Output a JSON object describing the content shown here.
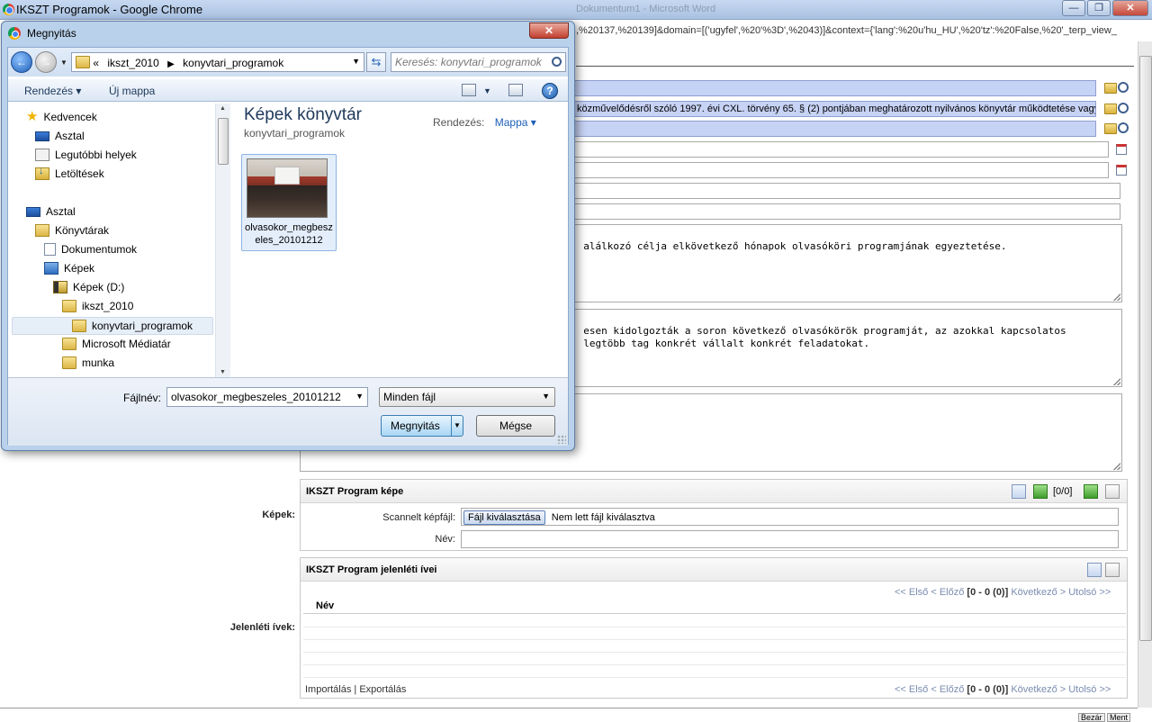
{
  "chrome": {
    "title": "IKSZT Programok - Google Chrome",
    "ghost_tabs": "Dokumentum1 - Microsoft Word",
    "url_fragment": ",%20137,%20139]&domain=[('ugyfel',%20'%3D',%2043)]&context={'lang':%20u'hu_HU',%20'tz':%20False,%20'_terp_view_"
  },
  "form": {
    "row_blue_2": "közművelődésről szóló 1997. évi CXL. törvény 65. § (2) pontjában meghatározott nyilvános könyvtár működtetése vagy",
    "textarea_1": "alálkozó célja elkövetkező hónapok olvasóköri programjának egyeztetése.",
    "textarea_2": "esen kidolgozták a soron következő olvasókörök programját, az azokkal kapcsolatos\n  legtöbb tag konkrét vállalt konkrét feladatokat.",
    "kepek_label": "Képek:",
    "jelenleti_label": "Jelenléti ívek:",
    "program_kepe": {
      "title": "IKSZT Program képe",
      "counter": "[0/0]",
      "scan_label": "Scannelt képfájl:",
      "file_button": "Fájl kiválasztása",
      "no_file": "Nem lett fájl kiválasztva",
      "name_label": "Név:"
    },
    "jelenleti": {
      "title": "IKSZT Program jelenléti ívei",
      "pager_prefix": "<< Első < Előző",
      "pager_range": "[0 - 0 (0)]",
      "pager_suffix": "Következő > Utolsó >>",
      "col_name": "Név",
      "import": "Importálás",
      "export": "Exportálás",
      "sep": "|"
    },
    "bottom_btn_1": "Bezár",
    "bottom_btn_2": "Ment"
  },
  "dialog": {
    "title": "Megnyitás",
    "close": "x",
    "breadcrumb": [
      "«",
      "ikszt_2010",
      "konyvtari_programok"
    ],
    "search_placeholder": "Keresés: konyvtari_programok",
    "toolbar": {
      "organize": "Rendezés",
      "new_folder": "Új mappa"
    },
    "nav": [
      {
        "label": "Kedvencek",
        "icon": "star-icon"
      },
      {
        "label": "Asztal",
        "icon": "desktop-icon"
      },
      {
        "label": "Legutóbbi helyek",
        "icon": "recent-places-icon"
      },
      {
        "label": "Letöltések",
        "icon": "downloads-icon"
      },
      {
        "label": "Asztal",
        "icon": "desktop-icon"
      },
      {
        "label": "Könyvtárak",
        "icon": "libraries-icon"
      },
      {
        "label": "Dokumentumok",
        "icon": "documents-icon"
      },
      {
        "label": "Képek",
        "icon": "pictures-icon"
      },
      {
        "label": "Képek (D:)",
        "icon": "drive-icon"
      },
      {
        "label": "ikszt_2010",
        "icon": "folder-icon"
      },
      {
        "label": "konyvtari_programok",
        "icon": "folder-icon"
      },
      {
        "label": "Microsoft Médiatár",
        "icon": "folder-icon"
      },
      {
        "label": "munka",
        "icon": "folder-icon"
      }
    ],
    "library_title": "Képek könyvtár",
    "library_subtitle": "konyvtari_programok",
    "arrange_label": "Rendezés:",
    "arrange_value": "Mappa",
    "file_item": "olvasokor_megbeszeles_20101212",
    "filename_label": "Fájlnév:",
    "filename_value": "olvasokor_megbeszeles_20101212",
    "filter_value": "Minden fájl",
    "open_button": "Megnyitás",
    "cancel_button": "Mégse"
  }
}
